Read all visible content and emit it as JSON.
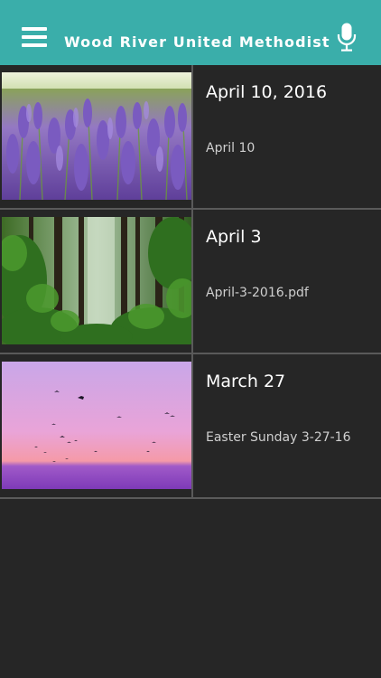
{
  "header": {
    "title": "Wood River United Methodist",
    "menu_icon": "hamburger-menu-icon",
    "mic_icon": "microphone-icon"
  },
  "colors": {
    "header_bg": "#3aaeaa",
    "list_bg": "#262626",
    "divider": "#5a5a5a",
    "title_text": "#ffffff",
    "subtitle_text": "#cfcfcf"
  },
  "sermons": [
    {
      "title": "April 10, 2016",
      "subtitle": "April 10",
      "image": "lavender-field"
    },
    {
      "title": "April 3",
      "subtitle": "April-3-2016.pdf",
      "image": "forest-trees"
    },
    {
      "title": "March 27",
      "subtitle": "Easter Sunday 3-27-16",
      "image": "birds-sunset"
    }
  ]
}
